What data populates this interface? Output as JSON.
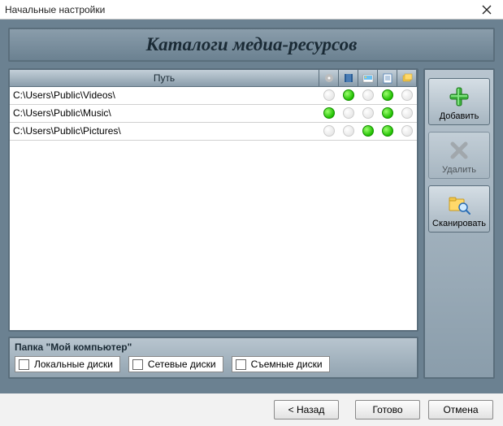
{
  "window": {
    "title": "Начальные настройки"
  },
  "heading": "Каталоги медиа-ресурсов",
  "table": {
    "path_header": "Путь",
    "rows": [
      {
        "path": "C:\\Users\\Public\\Videos\\",
        "flags": [
          false,
          true,
          false,
          true,
          false
        ]
      },
      {
        "path": "C:\\Users\\Public\\Music\\",
        "flags": [
          true,
          false,
          false,
          true,
          false
        ]
      },
      {
        "path": "C:\\Users\\Public\\Pictures\\",
        "flags": [
          false,
          false,
          true,
          true,
          false
        ]
      }
    ],
    "col_icons": [
      "music",
      "video",
      "image",
      "doc",
      "other"
    ]
  },
  "folder_group": {
    "legend": "Папка \"Мой компьютер\"",
    "options": {
      "local": {
        "label": "Локальные диски",
        "checked": false
      },
      "network": {
        "label": "Сетевые диски",
        "checked": false
      },
      "removable": {
        "label": "Съемные диски",
        "checked": false
      }
    }
  },
  "sidebar": {
    "add": "Добавить",
    "delete": "Удалить",
    "scan": "Сканировать"
  },
  "footer": {
    "back": "< Назад",
    "finish": "Готово",
    "cancel": "Отмена"
  }
}
